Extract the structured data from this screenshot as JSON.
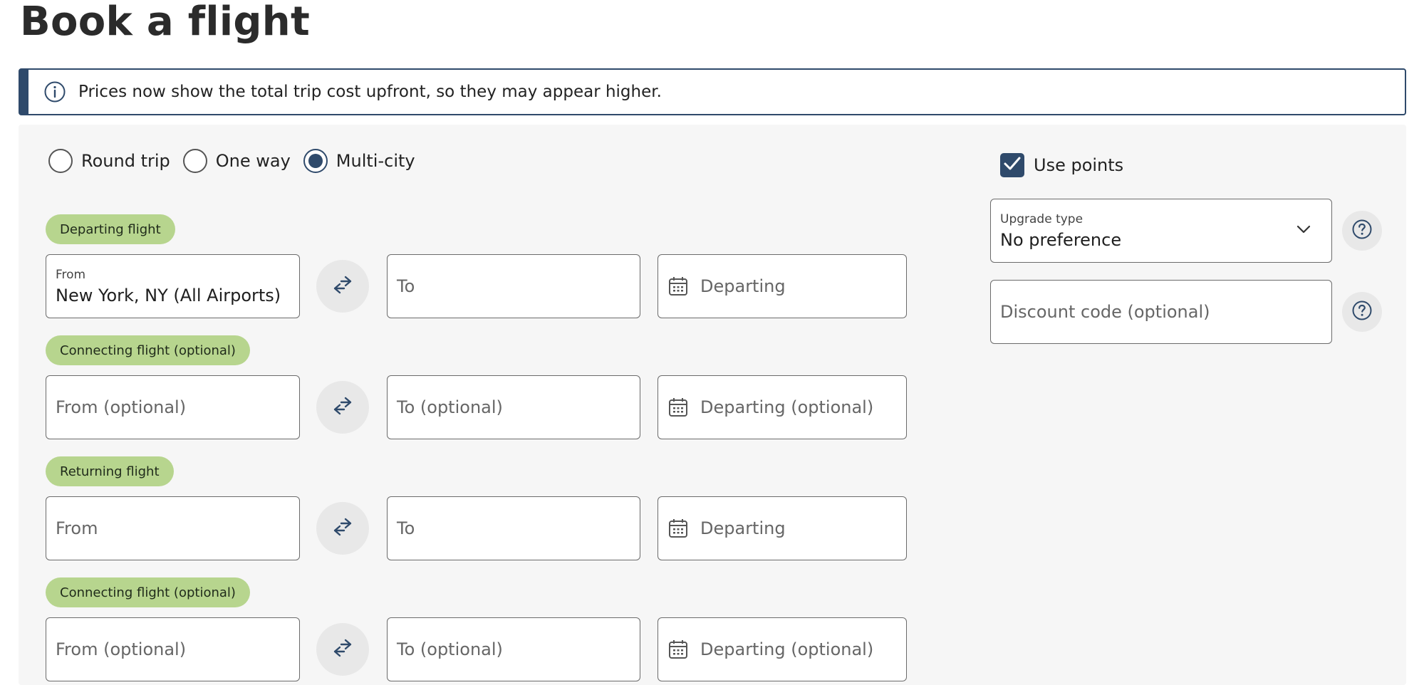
{
  "page": {
    "title": "Book a flight"
  },
  "notice": {
    "text": "Prices now show the total trip cost upfront, so they may appear higher."
  },
  "trip_types": [
    {
      "label": "Round trip",
      "checked": false
    },
    {
      "label": "One way",
      "checked": false
    },
    {
      "label": "Multi-city",
      "checked": true
    }
  ],
  "segments": [
    {
      "tag": "Departing flight",
      "from": {
        "label": "From",
        "value": "New York, NY (All Airports)"
      },
      "to": {
        "placeholder": "To"
      },
      "date": {
        "placeholder": "Departing"
      }
    },
    {
      "tag": "Connecting flight (optional)",
      "from": {
        "placeholder": "From (optional)"
      },
      "to": {
        "placeholder": "To (optional)"
      },
      "date": {
        "placeholder": "Departing (optional)"
      }
    },
    {
      "tag": "Returning flight",
      "from": {
        "placeholder": "From"
      },
      "to": {
        "placeholder": "To"
      },
      "date": {
        "placeholder": "Departing"
      }
    },
    {
      "tag": "Connecting flight (optional)",
      "from": {
        "placeholder": "From (optional)"
      },
      "to": {
        "placeholder": "To (optional)"
      },
      "date": {
        "placeholder": "Departing (optional)"
      }
    }
  ],
  "options": {
    "use_points": {
      "label": "Use points",
      "checked": true
    },
    "upgrade": {
      "label": "Upgrade type",
      "value": "No preference"
    },
    "discount": {
      "placeholder": "Discount code (optional)"
    }
  },
  "colors": {
    "primary": "#2f4a6b",
    "tag_green": "#b7d58e",
    "panel_bg": "#f6f6f6",
    "field_border": "#6b6b6b"
  }
}
